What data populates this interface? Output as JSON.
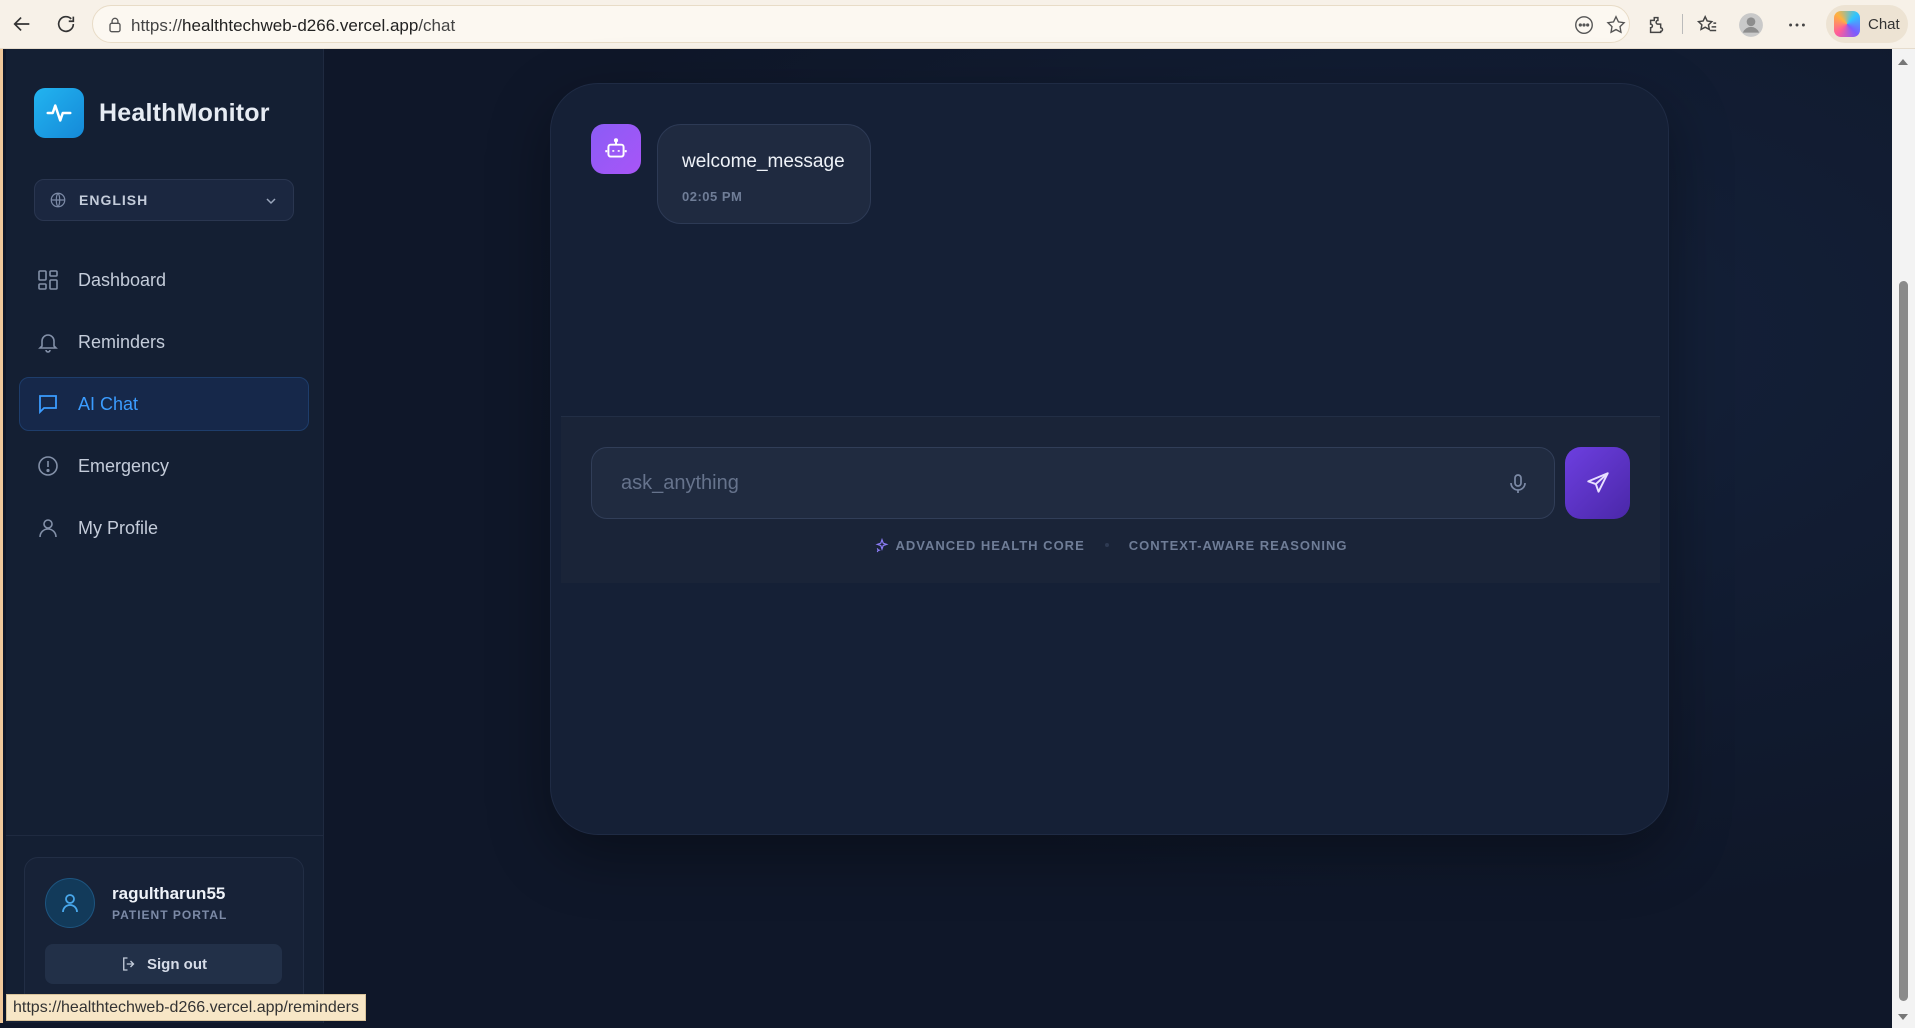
{
  "browser": {
    "url_prefix": "https://",
    "url_domain": "healthtechweb-d266.vercel.app",
    "url_path": "/chat",
    "copilot_label": "Chat",
    "status_url": "https://healthtechweb-d266.vercel.app/reminders"
  },
  "sidebar": {
    "brand": "HealthMonitor",
    "language": "ENGLISH",
    "items": [
      {
        "label": "Dashboard",
        "icon": "dashboard-icon",
        "active": false
      },
      {
        "label": "Reminders",
        "icon": "bell-icon",
        "active": false
      },
      {
        "label": "AI Chat",
        "icon": "chat-icon",
        "active": true
      },
      {
        "label": "Emergency",
        "icon": "alert-icon",
        "active": false
      },
      {
        "label": "My Profile",
        "icon": "user-icon",
        "active": false
      }
    ],
    "user": {
      "name": "ragultharun55",
      "role": "PATIENT PORTAL",
      "signout_label": "Sign out"
    }
  },
  "chat": {
    "messages": [
      {
        "sender": "bot",
        "text": "welcome_message",
        "time": "02:05 PM"
      }
    ],
    "input_placeholder": "ask_anything",
    "features": [
      "ADVANCED HEALTH CORE",
      "CONTEXT-AWARE REASONING"
    ]
  },
  "colors": {
    "accent": "#3b9cff",
    "brand": "#22b4f0",
    "bot": "#8b5cf6",
    "send": "#6d3fe0",
    "background": "#0f1729"
  }
}
